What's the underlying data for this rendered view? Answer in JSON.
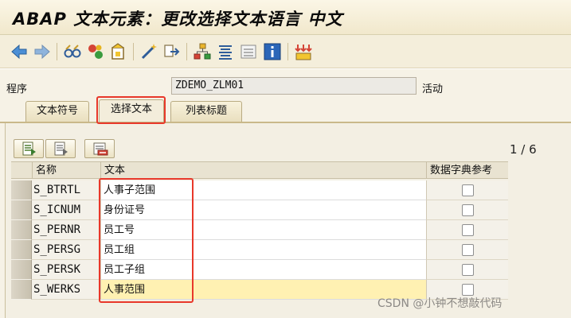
{
  "window": {
    "title": "ABAP 文本元素：更改选择文本语言 中文"
  },
  "toolbar": {
    "icons": [
      "back-arrow-icon",
      "forward-arrow-icon",
      "glasses-icon",
      "activate-icon",
      "other-object-icon",
      "wand-icon",
      "navigation-icon",
      "hierarchy-icon",
      "text-lines-icon",
      "list-icon",
      "info-icon",
      "mass-change-icon"
    ]
  },
  "program": {
    "label": "程序",
    "value": "ZDEMO_ZLM01",
    "status": "活动"
  },
  "tabs": [
    {
      "label": "文本符号",
      "active": false
    },
    {
      "label": "选择文本",
      "active": true
    },
    {
      "label": "列表标题",
      "active": false
    }
  ],
  "pager": {
    "text": "1 / 6"
  },
  "grid": {
    "headers": {
      "name": "名称",
      "text": "文本",
      "dict": "数据字典参考"
    },
    "rows": [
      {
        "name": "S_BTRTL",
        "text": "人事子范围",
        "checked": false
      },
      {
        "name": "S_ICNUM",
        "text": "身份证号",
        "checked": false
      },
      {
        "name": "S_PERNR",
        "text": "员工号",
        "checked": false
      },
      {
        "name": "S_PERSG",
        "text": "员工组",
        "checked": false
      },
      {
        "name": "S_PERSK",
        "text": "员工子组",
        "checked": false
      },
      {
        "name": "S_WERKS",
        "text": "人事范围",
        "checked": false
      }
    ]
  },
  "watermark": {
    "text": "CSDN @小钟不想敲代码"
  },
  "colors": {
    "highlight": "#e8382a",
    "current_row": "#fff1b2",
    "title_bg": "#f1e8cc"
  }
}
